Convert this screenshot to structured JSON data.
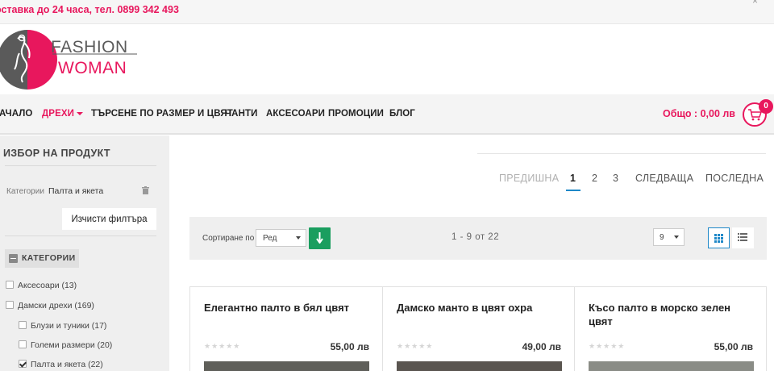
{
  "topbar": {
    "delivery_text": "оставка до 24 часа, тел. 0899 342 493",
    "close_label": "×"
  },
  "logo": {
    "line1": "FASHION",
    "line2": "WOMAN",
    "brand_pink": "#e8175d",
    "brand_gray": "#5a5a5a"
  },
  "nav": {
    "items": [
      "АЧАЛО",
      "ДРЕХИ",
      "ТЪРСЕНЕ ПО РАЗМЕР И ЦВЯТ",
      "ЧАНТИ",
      "АКСЕСОАРИ",
      "ПРОМОЦИИ",
      "БЛОГ"
    ],
    "active_item": "ДРЕХИ",
    "total": "Общо : 0,00 лв",
    "cart_count": "0",
    "cart_icon": "shopping-cart-icon"
  },
  "sidebar": {
    "title": "ИЗБОР НА ПРОДУКТ",
    "filter_key": "Категории",
    "filter_value": "Палта и якета",
    "clear_button": "Изчисти филтъра",
    "categories_heading": "КАТЕГОРИИ",
    "categories": [
      {
        "label": "Аксесоари (13)",
        "checked": false
      },
      {
        "label": "Дамски дрехи (169)",
        "checked": false
      },
      {
        "label": "Блузи и туники (17)",
        "checked": false
      },
      {
        "label": "Големи размери (20)",
        "checked": false
      },
      {
        "label": "Палта и якета (22)",
        "checked": true
      }
    ]
  },
  "pagination": {
    "prev": "ПРЕДИШНА",
    "pages": [
      "1",
      "2",
      "3"
    ],
    "current": "1",
    "next": "СЛЕДВАЩА",
    "last": "ПОСЛЕДНА"
  },
  "toolbar": {
    "sort_label": "Сортиране по",
    "sort_value": "Ред",
    "range_text": "1 - 9  от  22",
    "per_page": "9",
    "accent": "#1a9e5f",
    "view_accent": "#1e88c8"
  },
  "products": [
    {
      "name": "Елегантно палто в бял цвят",
      "price": "55,00 лв",
      "rating": 0
    },
    {
      "name": "Дамско манто в цвят охра",
      "price": "49,00 лв",
      "rating": 0
    },
    {
      "name": "Късо палто в морско зелен цвят",
      "price": "55,00 лв",
      "rating": 0
    }
  ]
}
